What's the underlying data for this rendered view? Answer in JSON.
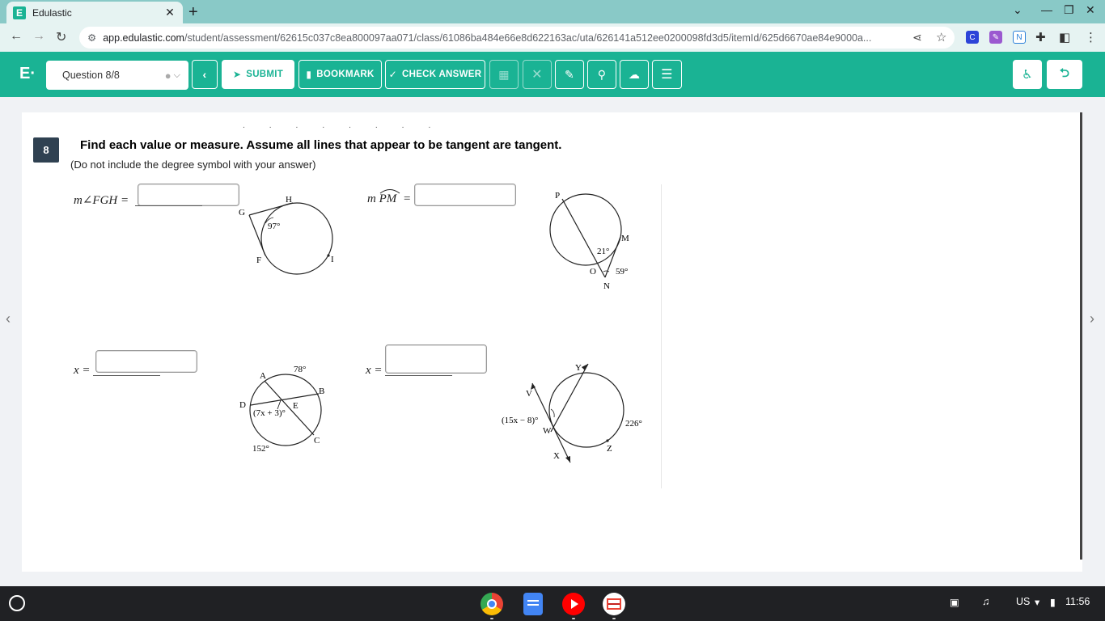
{
  "browser": {
    "tab_title": "Edulastic",
    "url_domain": "app.edulastic.com",
    "url_path": "/student/assessment/62615c037c8ea800097aa071/class/61086ba484e66e8d622163ac/uta/626141a512ee0200098fd3d5/itemId/625d6670ae84e9000a..."
  },
  "toolbar": {
    "question_selector": "Question 8/8",
    "submit_label": "SUBMIT",
    "bookmark_label": "BOOKMARK",
    "check_answer_label": "CHECK ANSWER"
  },
  "question": {
    "number": "8",
    "title": "Find each value or measure.  Assume all lines that appear to be tangent are tangent.",
    "subtitle": "(Do not include the degree symbol with your answer)"
  },
  "problems": {
    "p1": {
      "label": "m∠FGH =",
      "figure": {
        "arc": "97°",
        "points": [
          "G",
          "H",
          "F",
          "I"
        ]
      }
    },
    "p2": {
      "label_prefix": "m",
      "label_arc": "PM",
      "label_eq": "=",
      "figure": {
        "angle1": "21°",
        "angle2": "59°",
        "points": [
          "P",
          "M",
          "O",
          "N"
        ]
      }
    },
    "p3": {
      "label": "x =",
      "figure": {
        "arc_top": "78°",
        "arc_bottom": "152°",
        "angle": "(7x + 3)°",
        "points": [
          "A",
          "B",
          "C",
          "D",
          "E"
        ]
      }
    },
    "p4": {
      "label": "x =",
      "figure": {
        "angle": "(15x − 8)°",
        "arc": "226°",
        "points": [
          "Y",
          "V",
          "W",
          "X",
          "Z"
        ]
      }
    }
  },
  "shelf": {
    "locale": "US",
    "time": "11:56"
  },
  "colors": {
    "brand": "#1ab394",
    "tab_strip": "#89c9c7",
    "question_badge": "#2f4151"
  }
}
